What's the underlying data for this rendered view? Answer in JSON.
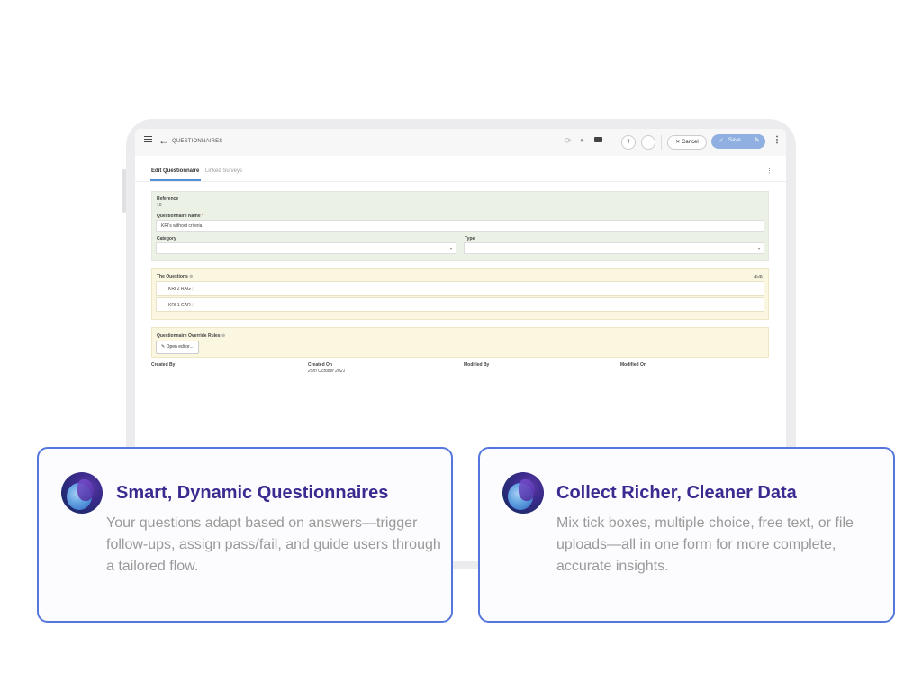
{
  "app": {
    "title": "QUESTIONNAIRES",
    "cancel_label": "Cancel",
    "save_label": "Save",
    "plus_icon": "plus-icon",
    "minus_icon": "minus-icon"
  },
  "tabs": [
    {
      "label": "Edit Questionnaire",
      "active": true
    },
    {
      "label": "Linked Surveys",
      "active": false
    }
  ],
  "form": {
    "reference_label": "Reference",
    "reference_value": "10",
    "name_label": "Questionnaire Name",
    "name_required": "*",
    "name_value": "KRI's without criteria",
    "category_label": "Category",
    "category_value": "",
    "type_label": "Type",
    "type_value": ""
  },
  "questions": {
    "title": "The Questions",
    "items": [
      {
        "label": "KRI 2 RAG"
      },
      {
        "label": "KRI 1 GAR"
      }
    ]
  },
  "override": {
    "title": "Questionnaire Override Rules",
    "open_editor_label": "Open editor..."
  },
  "meta": {
    "created_by_label": "Created By",
    "created_on_label": "Created On",
    "created_on_value": "25th October 2021",
    "modified_by_label": "Modified By",
    "modified_on_label": "Modified On"
  },
  "cards": [
    {
      "title": "Smart, Dynamic Questionnaires",
      "text": "Your questions adapt based on answers—trigger follow-ups, assign pass/fail, and guide users through a tailored flow."
    },
    {
      "title": "Collect Richer, Cleaner Data",
      "text": "Mix tick boxes, multiple choice, free text, or file uploads—all in one form for more complete, accurate insights."
    }
  ],
  "colors": {
    "accent": "#5577dd",
    "card_title": "#3b2a90",
    "save_button": "#8fb0e0",
    "panel_green": "#ecf1e6",
    "panel_yellow": "#fbf6df"
  }
}
